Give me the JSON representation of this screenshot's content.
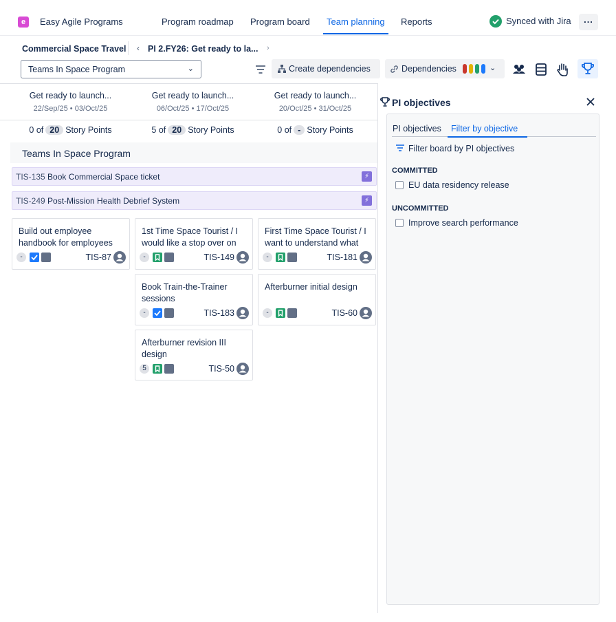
{
  "nav": {
    "logo_letter": "e",
    "app_name": "Easy Agile Programs",
    "tabs": [
      "Program roadmap",
      "Program board",
      "Team planning",
      "Reports"
    ],
    "active_tab": "Team planning",
    "sync_status": "Synced with Jira",
    "more_label": "..."
  },
  "breadcrumb": {
    "program": "Commercial Space Travel",
    "increment": "PI 2.FY26: Get ready to la...",
    "back_icon": "chevron-left-icon",
    "forward_icon": "chevron-right-icon"
  },
  "toolbar": {
    "team_select_value": "Teams In Space Program",
    "create_dependencies_label": "Create dependencies",
    "dependencies_label": "Dependencies",
    "dependency_colors": [
      "#c9372c",
      "#e2b203",
      "#22a06b",
      "#1d7afc"
    ]
  },
  "board": {
    "columns": [
      {
        "title": "Get ready to launch...",
        "dates": "22/Sep/25 • 03/Oct/25",
        "pts_pre": "0 of",
        "pts_total": "20",
        "pts_post": "Story Points"
      },
      {
        "title": "Get ready to launch...",
        "dates": "06/Oct/25 • 17/Oct/25",
        "pts_pre": "5 of",
        "pts_total": "20",
        "pts_post": "Story Points"
      },
      {
        "title": "Get ready to launch...",
        "dates": "20/Oct/25 • 31/Oct/25",
        "pts_pre": "0 of",
        "pts_total": "-",
        "pts_post": "Story Points"
      }
    ],
    "team_name": "Teams In Space Program",
    "features": [
      {
        "key": "TIS-135",
        "title": "Book Commercial Space ticket"
      },
      {
        "key": "TIS-249",
        "title": "Post-Mission Health Debrief System"
      }
    ],
    "cards": [
      {
        "title": "Build out employee handbook for employees",
        "estimate": "-",
        "type": "task",
        "key": "TIS-87"
      },
      {
        "title": "1st Time Space Tourist / I would like a stop over on",
        "estimate": "-",
        "type": "story",
        "key": "TIS-149"
      },
      {
        "title": "First Time Space Tourist / I want to understand what",
        "estimate": "-",
        "type": "story",
        "key": "TIS-181"
      },
      {
        "title": "Book Train-the-Trainer sessions",
        "estimate": "-",
        "type": "task",
        "key": "TIS-183"
      },
      {
        "title": "Afterburner initial design",
        "estimate": "-",
        "type": "story",
        "key": "TIS-60"
      },
      {
        "title": "Afterburner revision III design",
        "estimate": "5",
        "type": "story",
        "key": "TIS-50"
      }
    ]
  },
  "panel": {
    "title": "PI objectives",
    "tabs": [
      "PI objectives",
      "Filter by objective"
    ],
    "active_tab": "Filter by objective",
    "filter_label": "Filter board by PI objectives",
    "committed_heading": "COMMITTED",
    "committed": [
      "EU data residency release"
    ],
    "uncommitted_heading": "UNCOMMITTED",
    "uncommitted": [
      "Improve search performance"
    ]
  }
}
